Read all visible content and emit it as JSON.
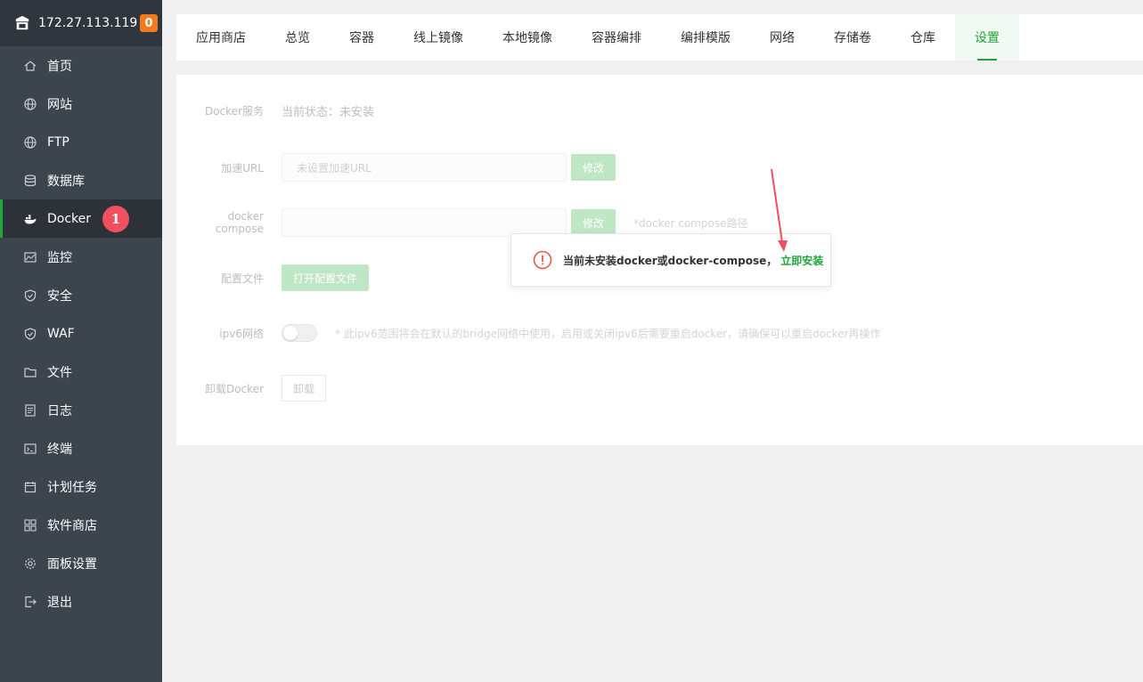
{
  "sidebar": {
    "server_ip": "172.27.113.119",
    "notification_count": "0",
    "items": [
      {
        "label": "首页",
        "icon": "home-icon"
      },
      {
        "label": "网站",
        "icon": "globe-icon"
      },
      {
        "label": "FTP",
        "icon": "globe-icon"
      },
      {
        "label": "数据库",
        "icon": "database-icon"
      },
      {
        "label": "Docker",
        "icon": "docker-icon"
      },
      {
        "label": "监控",
        "icon": "monitor-icon"
      },
      {
        "label": "安全",
        "icon": "shield-icon"
      },
      {
        "label": "WAF",
        "icon": "shield-icon"
      },
      {
        "label": "文件",
        "icon": "folder-icon"
      },
      {
        "label": "日志",
        "icon": "log-icon"
      },
      {
        "label": "终端",
        "icon": "terminal-icon"
      },
      {
        "label": "计划任务",
        "icon": "calendar-icon"
      },
      {
        "label": "软件商店",
        "icon": "grid-icon"
      },
      {
        "label": "面板设置",
        "icon": "gear-icon"
      },
      {
        "label": "退出",
        "icon": "logout-icon"
      }
    ],
    "active_index": 4,
    "step_badge": "1"
  },
  "tabs": [
    "应用商店",
    "总览",
    "容器",
    "线上镜像",
    "本地镜像",
    "容器编排",
    "编排模版",
    "网络",
    "存储卷",
    "仓库",
    "设置"
  ],
  "active_tab": "设置",
  "settings": {
    "docker_service_label": "Docker服务",
    "docker_status": "当前状态：未安装",
    "mirror_label": "加速URL",
    "mirror_placeholder": "未设置加速URL",
    "modify_button": "修改",
    "compose_label": "docker compose",
    "compose_value": "",
    "compose_hint": "*docker compose路径",
    "config_label": "配置文件",
    "open_config_button": "打开配置文件",
    "ipv6_label": "ipv6网络",
    "ipv6_enabled": false,
    "ipv6_hint": "* 此ipv6范围将会在默认的bridge网络中使用，启用或关闭ipv6后需要重启docker，请确保可以重启docker再操作",
    "uninstall_label": "卸载Docker",
    "uninstall_button": "卸载"
  },
  "popup": {
    "message": "当前未安装docker或docker-compose，",
    "link": "立即安装"
  },
  "colors": {
    "accent": "#20a53a",
    "sidebar_bg": "#3c444d",
    "badge": "#ef4f5f",
    "warning": "#f37b1d"
  }
}
